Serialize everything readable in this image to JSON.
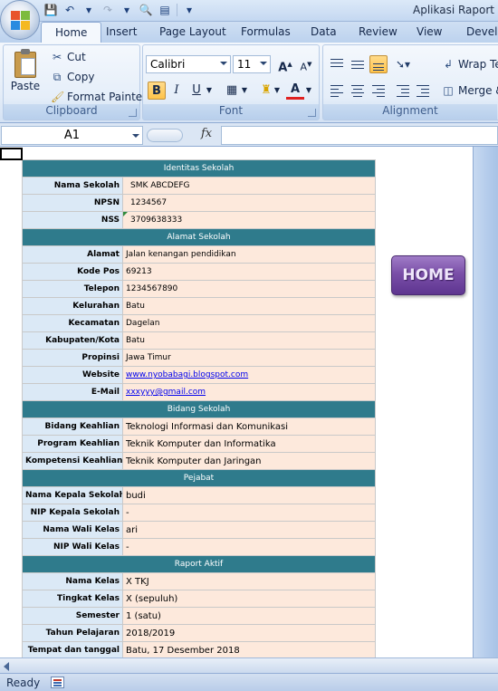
{
  "titlebar": {
    "app_title": "Aplikasi Raport X"
  },
  "ribbon": {
    "tabs": [
      "Home",
      "Insert",
      "Page Layout",
      "Formulas",
      "Data",
      "Review",
      "View",
      "Develo"
    ],
    "active_tab": "Home",
    "clipboard": {
      "paste": "Paste",
      "cut": "Cut",
      "copy": "Copy",
      "format_painter": "Format Painter",
      "label": "Clipboard"
    },
    "font": {
      "family": "Calibri",
      "size": "11",
      "bold": "B",
      "italic": "I",
      "underline": "U",
      "font_color": "A",
      "label": "Font"
    },
    "alignment": {
      "wrap_text": "Wrap Te",
      "merge": "Merge &",
      "label": "Alignment"
    }
  },
  "formula_bar": {
    "name_box": "A1",
    "fx": "fx",
    "formula": ""
  },
  "sheet": {
    "sections": [
      {
        "title": "Identitas Sekolah",
        "rows": [
          {
            "label": "Nama Sekolah",
            "value": "SMK ABCDEFG"
          },
          {
            "label": "NPSN",
            "value": "1234567"
          },
          {
            "label": "NSS",
            "value": "3709638333"
          }
        ]
      },
      {
        "title": "Alamat Sekolah",
        "rows": [
          {
            "label": "Alamat",
            "value": "Jalan kenangan pendidikan"
          },
          {
            "label": "Kode Pos",
            "value": "69213"
          },
          {
            "label": "Telepon",
            "value": "1234567890"
          },
          {
            "label": "Kelurahan",
            "value": "Batu"
          },
          {
            "label": "Kecamatan",
            "value": "Dagelan"
          },
          {
            "label": "Kabupaten/Kota",
            "value": "Batu"
          },
          {
            "label": "Propinsi",
            "value": "Jawa Timur"
          },
          {
            "label": "Website",
            "value": "www.nyobabagi.blogspot.com"
          },
          {
            "label": "E-Mail",
            "value": "xxxyyy@gmail.com"
          }
        ]
      },
      {
        "title": "Bidang Sekolah",
        "rows": [
          {
            "label": "Bidang Keahlian",
            "value": "Teknologi Informasi dan Komunikasi"
          },
          {
            "label": "Program Keahlian",
            "value": "Teknik Komputer dan Informatika"
          },
          {
            "label": "Kompetensi Keahlian",
            "value": "Teknik Komputer dan Jaringan"
          }
        ]
      },
      {
        "title": "Pejabat",
        "rows": [
          {
            "label": "Nama Kepala Sekolah",
            "value": "budi"
          },
          {
            "label": "NIP Kepala Sekolah",
            "value": "-"
          },
          {
            "label": "Nama Wali Kelas",
            "value": "ari"
          },
          {
            "label": "NIP Wali Kelas",
            "value": "-"
          }
        ]
      },
      {
        "title": "Raport Aktif",
        "rows": [
          {
            "label": "Nama Kelas",
            "value": "X TKJ"
          },
          {
            "label": "Tingkat Kelas",
            "value": "X (sepuluh)"
          },
          {
            "label": "Semester",
            "value": "1 (satu)"
          },
          {
            "label": "Tahun Pelajaran",
            "value": "2018/2019"
          },
          {
            "label": "Tempat dan tanggal",
            "value": "Batu, 17 Desember 2018"
          }
        ]
      }
    ],
    "home_button": "HOME"
  },
  "statusbar": {
    "status": "Ready"
  },
  "colors": {
    "section_header": "#2f7b8c",
    "label_bg": "#dbe9f6",
    "value_bg": "#fde9dc",
    "home_button": "#7a4fa8"
  }
}
